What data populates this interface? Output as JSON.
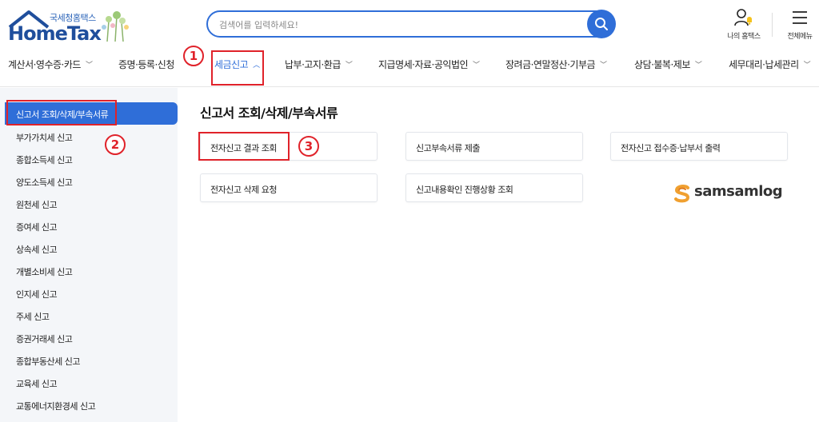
{
  "header": {
    "logo_org": "국세청홈택스",
    "logo_name": "HomeTax",
    "search_placeholder": "검색어를 입력하세요!",
    "utils": [
      {
        "label": "나의 홈택스",
        "icon": "user-bell-icon"
      },
      {
        "label": "전체메뉴",
        "icon": "hamburger-menu-icon"
      }
    ]
  },
  "gnb": {
    "items": [
      {
        "label": "계산서·영수증·카드",
        "has_chevron": true
      },
      {
        "label": "증명·등록·신청",
        "has_chevron": false
      },
      {
        "label": "세금신고",
        "has_chevron": true,
        "active": true
      },
      {
        "label": "납부·고지·환급",
        "has_chevron": true
      },
      {
        "label": "지급명세·자료·공익법인",
        "has_chevron": true
      },
      {
        "label": "장려금·연말정산·기부금",
        "has_chevron": true
      },
      {
        "label": "상담·불복·제보",
        "has_chevron": true
      },
      {
        "label": "세무대리·납세관리",
        "has_chevron": true
      }
    ]
  },
  "annotations": [
    "1",
    "2",
    "3"
  ],
  "sidebar": {
    "active_label": "신고서 조회/삭제/부속서류",
    "items": [
      "부가가치세 신고",
      "종합소득세 신고",
      "양도소득세 신고",
      "원천세 신고",
      "증여세 신고",
      "상속세 신고",
      "개별소비세 신고",
      "인지세 신고",
      "주세 신고",
      "증권거래세 신고",
      "종합부동산세 신고",
      "교육세 신고",
      "교통에너지환경세 신고"
    ]
  },
  "content": {
    "title": "신고서 조회/삭제/부속서류",
    "cards": [
      "전자신고 결과 조회",
      "신고부속서류 제출",
      "전자신고 접수증·납부서 출력",
      "전자신고 삭제 요청",
      "신고내용확인 진행상황 조회"
    ]
  },
  "watermark": {
    "text": "samsamlog"
  },
  "colors": {
    "accent": "#2f6ed8",
    "highlight": "#e0222a",
    "sidebar_bg": "#f4f6f9"
  }
}
